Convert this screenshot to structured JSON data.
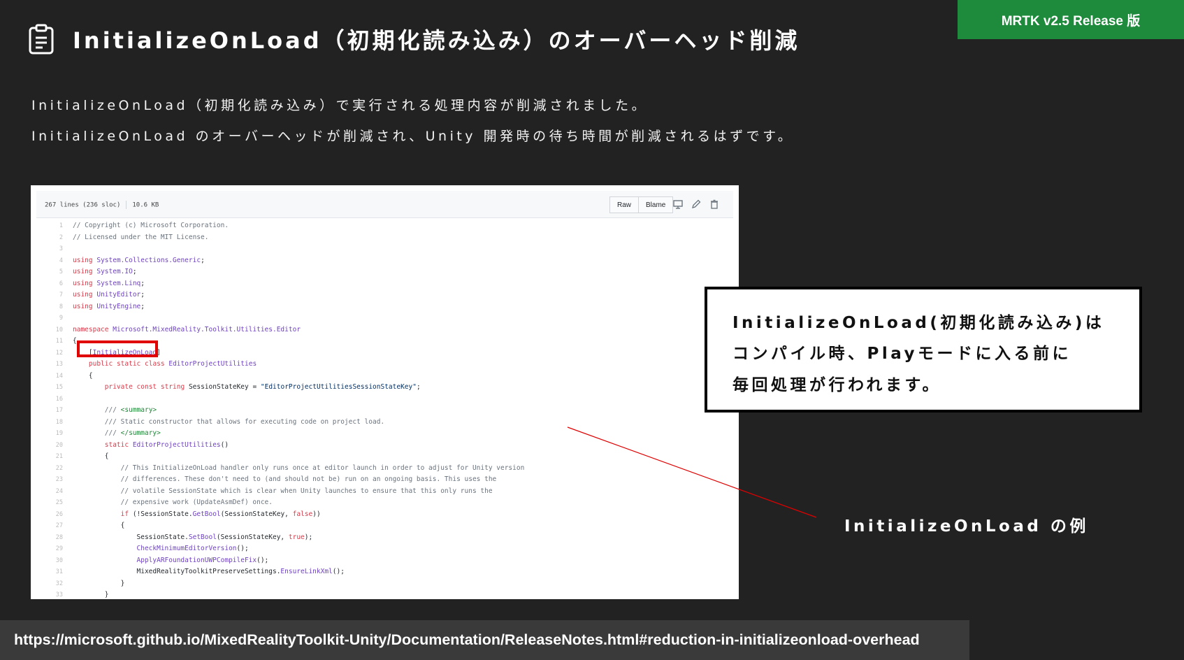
{
  "badge": "MRTK v2.5 Release 版",
  "slide": {
    "title": "InitializeOnLoad（初期化読み込み）のオーバーヘッド削減",
    "description": [
      "InitializeOnLoad（初期化読み込み）で実行される処理内容が削減されました。",
      "InitializeOnLoad のオーバーヘッドが削減され、Unity 開発時の待ち時間が削減されるはずです。"
    ]
  },
  "code_view": {
    "file_info": {
      "lines": "267 lines (236 sloc)",
      "size": "10.6 KB"
    },
    "buttons": {
      "raw": "Raw",
      "blame": "Blame"
    },
    "icons": [
      "desktop-icon",
      "pencil-icon",
      "trash-icon"
    ],
    "highlight_color": "#e00000",
    "lines": [
      "// Copyright (c) Microsoft Corporation.",
      "// Licensed under the MIT License.",
      "",
      "using System.Collections.Generic;",
      "using System.IO;",
      "using System.Linq;",
      "using UnityEditor;",
      "using UnityEngine;",
      "",
      "namespace Microsoft.MixedReality.Toolkit.Utilities.Editor",
      "{",
      "    [InitializeOnLoad]",
      "    public static class EditorProjectUtilities",
      "    {",
      "        private const string SessionStateKey = \"EditorProjectUtilitiesSessionStateKey\";",
      "",
      "        /// <summary>",
      "        /// Static constructor that allows for executing code on project load.",
      "        /// </summary>",
      "        static EditorProjectUtilities()",
      "        {",
      "            // This InitializeOnLoad handler only runs once at editor launch in order to adjust for Unity version",
      "            // differences. These don't need to (and should not be) run on an ongoing basis. This uses the",
      "            // volatile SessionState which is clear when Unity launches to ensure that this only runs the",
      "            // expensive work (UpdateAsmDef) once.",
      "            if (!SessionState.GetBool(SessionStateKey, false))",
      "            {",
      "                SessionState.SetBool(SessionStateKey, true);",
      "                CheckMinimumEditorVersion();",
      "                ApplyARFoundationUWPCompileFix();",
      "                MixedRealityToolkitPreserveSettings.EnsureLinkXml();",
      "            }",
      "        }"
    ]
  },
  "callout": {
    "lines": [
      "InitializeOnLoad(初期化読み込み)は",
      "コンパイル時、Playモードに入る前に",
      "毎回処理が行われます。"
    ]
  },
  "example_label": "InitializeOnLoad の例",
  "source_url": "https://microsoft.github.io/MixedRealityToolkit-Unity/Documentation/ReleaseNotes.html#reduction-in-initializeonload-overhead",
  "colors": {
    "background": "#222222",
    "badge": "#1e8a3c",
    "url_bar": "#3a3a3a",
    "connector": "#e00000"
  }
}
